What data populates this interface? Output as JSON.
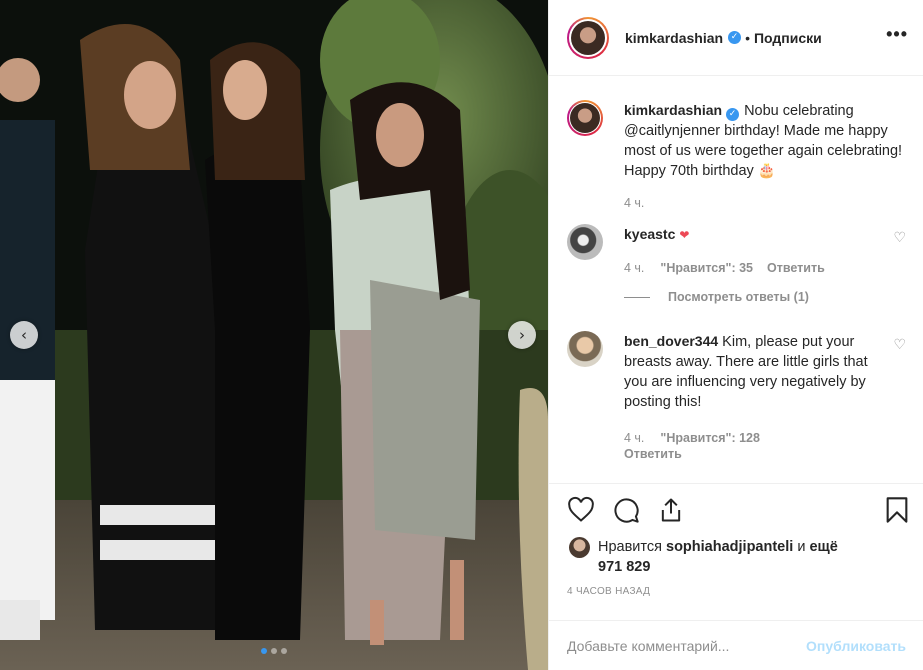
{
  "photo": {
    "prev_icon": "chevron-left-icon",
    "next_icon": "chevron-right-icon",
    "dots": {
      "count": 3,
      "active_index": 0
    }
  },
  "header": {
    "username": "kimkardashian",
    "verified_icon": "verified-badge-icon",
    "separator": "•",
    "follow_label": "Подписки",
    "more_icon": "more-options-icon"
  },
  "caption": {
    "username": "kimkardashian",
    "text": "Nobu celebrating @caitlynjenner birthday! Made me happy most of us were together again celebrating! Happy 70th birthday 🎂",
    "time": "4 ч."
  },
  "comments": [
    {
      "username": "kyeastc",
      "text": "❤",
      "time": "4 ч.",
      "likes_label": "\"Нравится\": 35",
      "reply_label": "Ответить",
      "view_replies": "Посмотреть ответы (1)"
    },
    {
      "username": "ben_dover344",
      "text": "Kim, please put your breasts away. There are little girls that you are influencing very negatively by posting this!",
      "time": "4 ч.",
      "likes_label": "\"Нравится\": 128",
      "reply_label": "Ответить"
    }
  ],
  "actions": {
    "like_icon": "heart-icon",
    "comment_icon": "comment-icon",
    "share_icon": "share-icon",
    "save_icon": "bookmark-icon",
    "liked_by_prefix": "Нравится",
    "liked_by_user": "sophiahadjipanteli",
    "liked_by_and": "и",
    "liked_by_more": "ещё 971 829",
    "time_ago": "4 часов назад"
  },
  "add_comment": {
    "placeholder": "Добавьте комментарий...",
    "publish_label": "Опубликовать"
  },
  "colors": {
    "accent": "#3897f0",
    "publish_disabled": "#b2dffc",
    "muted": "#8e8e8e",
    "text": "#262626",
    "heart_red": "#ed4956"
  }
}
